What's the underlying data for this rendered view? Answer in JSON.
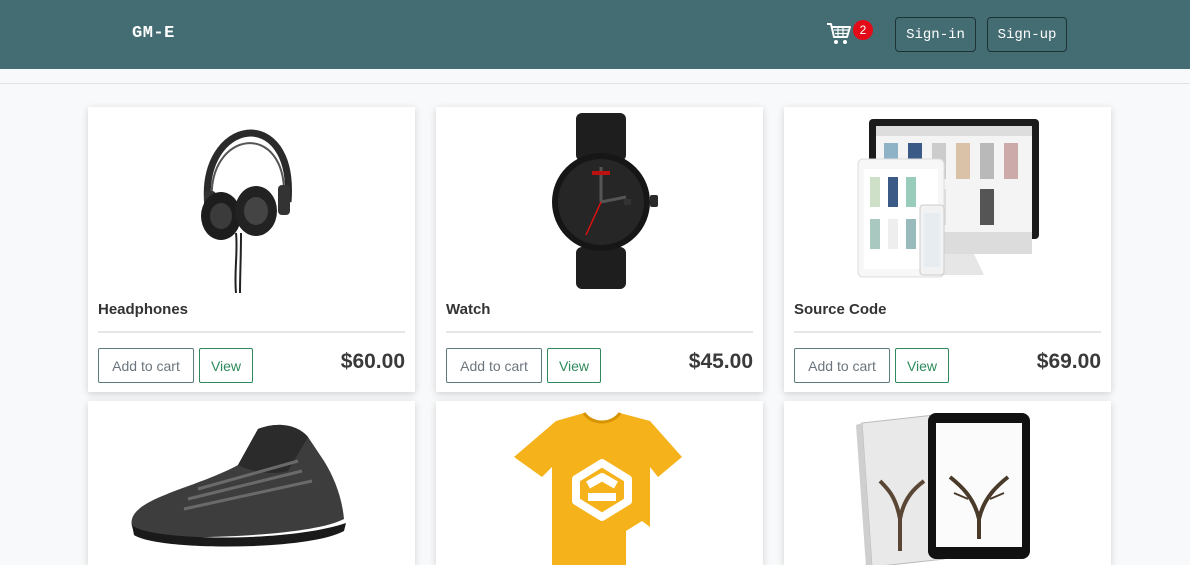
{
  "header": {
    "brand": "GM-E",
    "cart_count": "2",
    "signin_label": "Sign-in",
    "signup_label": "Sign-up"
  },
  "products": [
    {
      "title": "Headphones",
      "price": "$60.00",
      "add_label": "Add to cart",
      "view_label": "View",
      "image": "headphones-image"
    },
    {
      "title": "Watch",
      "price": "$45.00",
      "add_label": "Add to cart",
      "view_label": "View",
      "image": "watch-image"
    },
    {
      "title": "Source Code",
      "price": "$69.00",
      "add_label": "Add to cart",
      "view_label": "View",
      "image": "source-code-image"
    },
    {
      "title": "",
      "price": "",
      "image": "sneaker-image"
    },
    {
      "title": "",
      "price": "",
      "image": "tshirt-image"
    },
    {
      "title": "",
      "price": "",
      "image": "book-image"
    }
  ],
  "colors": {
    "navbar": "#446d73",
    "badge": "#e30b17",
    "view_button": "#2e8a5c"
  }
}
